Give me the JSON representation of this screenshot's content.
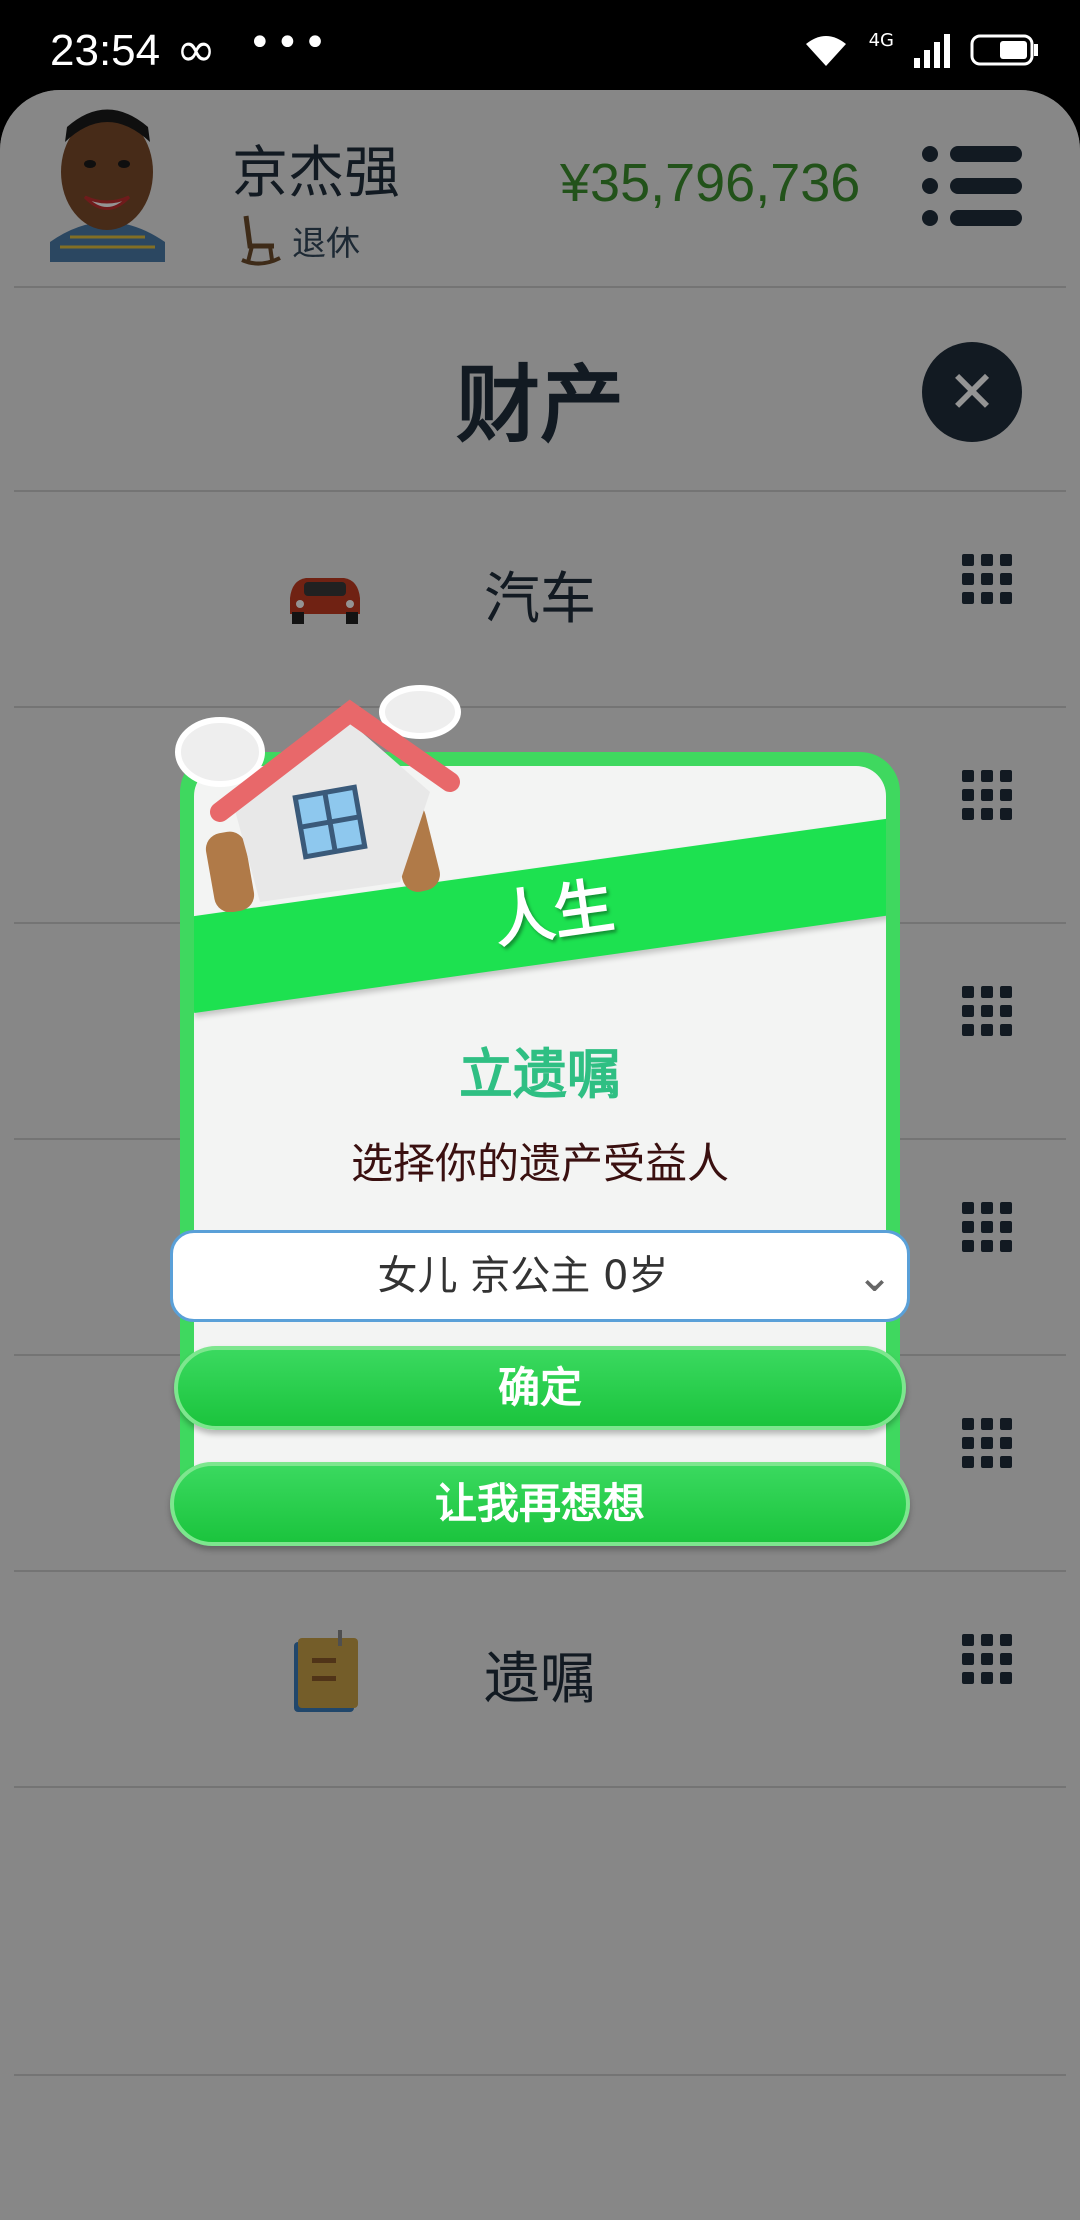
{
  "status": {
    "time": "23:54",
    "infinity": "∞",
    "dots": "•••",
    "net": "4G"
  },
  "header": {
    "name": "京杰强",
    "job": "退休",
    "money": "¥35,796,736"
  },
  "page": {
    "title": "财产"
  },
  "rows": [
    {
      "label": "汽车"
    },
    {
      "label": ""
    },
    {
      "label": ""
    },
    {
      "label": ""
    },
    {
      "label": ""
    },
    {
      "label": "遗嘱"
    }
  ],
  "dialog": {
    "ribbon": "人生",
    "title": "立遗嘱",
    "subtitle": "选择你的遗产受益人",
    "select_value": "女儿 京公主 0岁",
    "confirm": "确定",
    "cancel": "让我再想想"
  }
}
